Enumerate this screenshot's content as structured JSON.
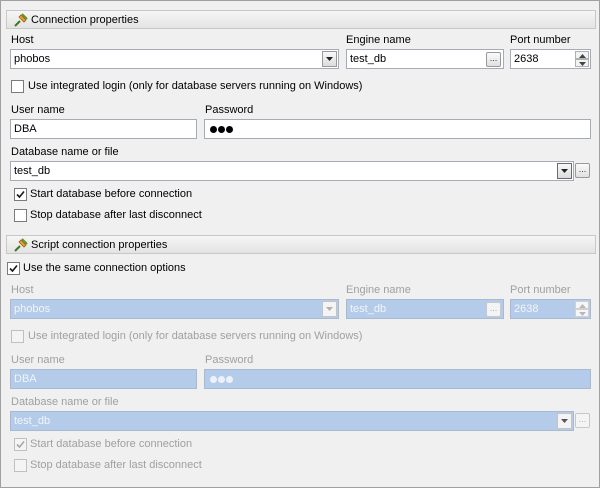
{
  "connection": {
    "header": "Connection properties",
    "host_label": "Host",
    "host_value": "phobos",
    "engine_label": "Engine name",
    "engine_value": "test_db",
    "port_label": "Port number",
    "port_value": "2638",
    "integrated_login_label": "Use integrated login (only for database servers running on Windows)",
    "integrated_login_checked": false,
    "username_label": "User name",
    "username_value": "DBA",
    "password_label": "Password",
    "password_dots": 3,
    "dbname_label": "Database name or file",
    "dbname_value": "test_db",
    "start_db_label": "Start database before connection",
    "start_db_checked": true,
    "stop_db_label": "Stop database after last disconnect",
    "stop_db_checked": false
  },
  "script": {
    "header": "Script connection properties",
    "same_options_label": "Use the same connection options",
    "same_options_checked": true,
    "host_label": "Host",
    "host_value": "phobos",
    "engine_label": "Engine name",
    "engine_value": "test_db",
    "port_label": "Port number",
    "port_value": "2638",
    "integrated_login_label": "Use integrated login (only for database servers running on Windows)",
    "integrated_login_checked": false,
    "username_label": "User name",
    "username_value": "DBA",
    "password_label": "Password",
    "password_dots": 3,
    "dbname_label": "Database name or file",
    "dbname_value": "test_db",
    "start_db_label": "Start database before connection",
    "start_db_checked": true,
    "stop_db_label": "Stop database after last disconnect",
    "stop_db_checked": false
  },
  "icons": {
    "header_icon": "connection-plug-icon",
    "ellipsis": "...",
    "colors": {
      "disabled_field": "#b4cbe9",
      "disabled_text": "#a0a0a0"
    }
  }
}
